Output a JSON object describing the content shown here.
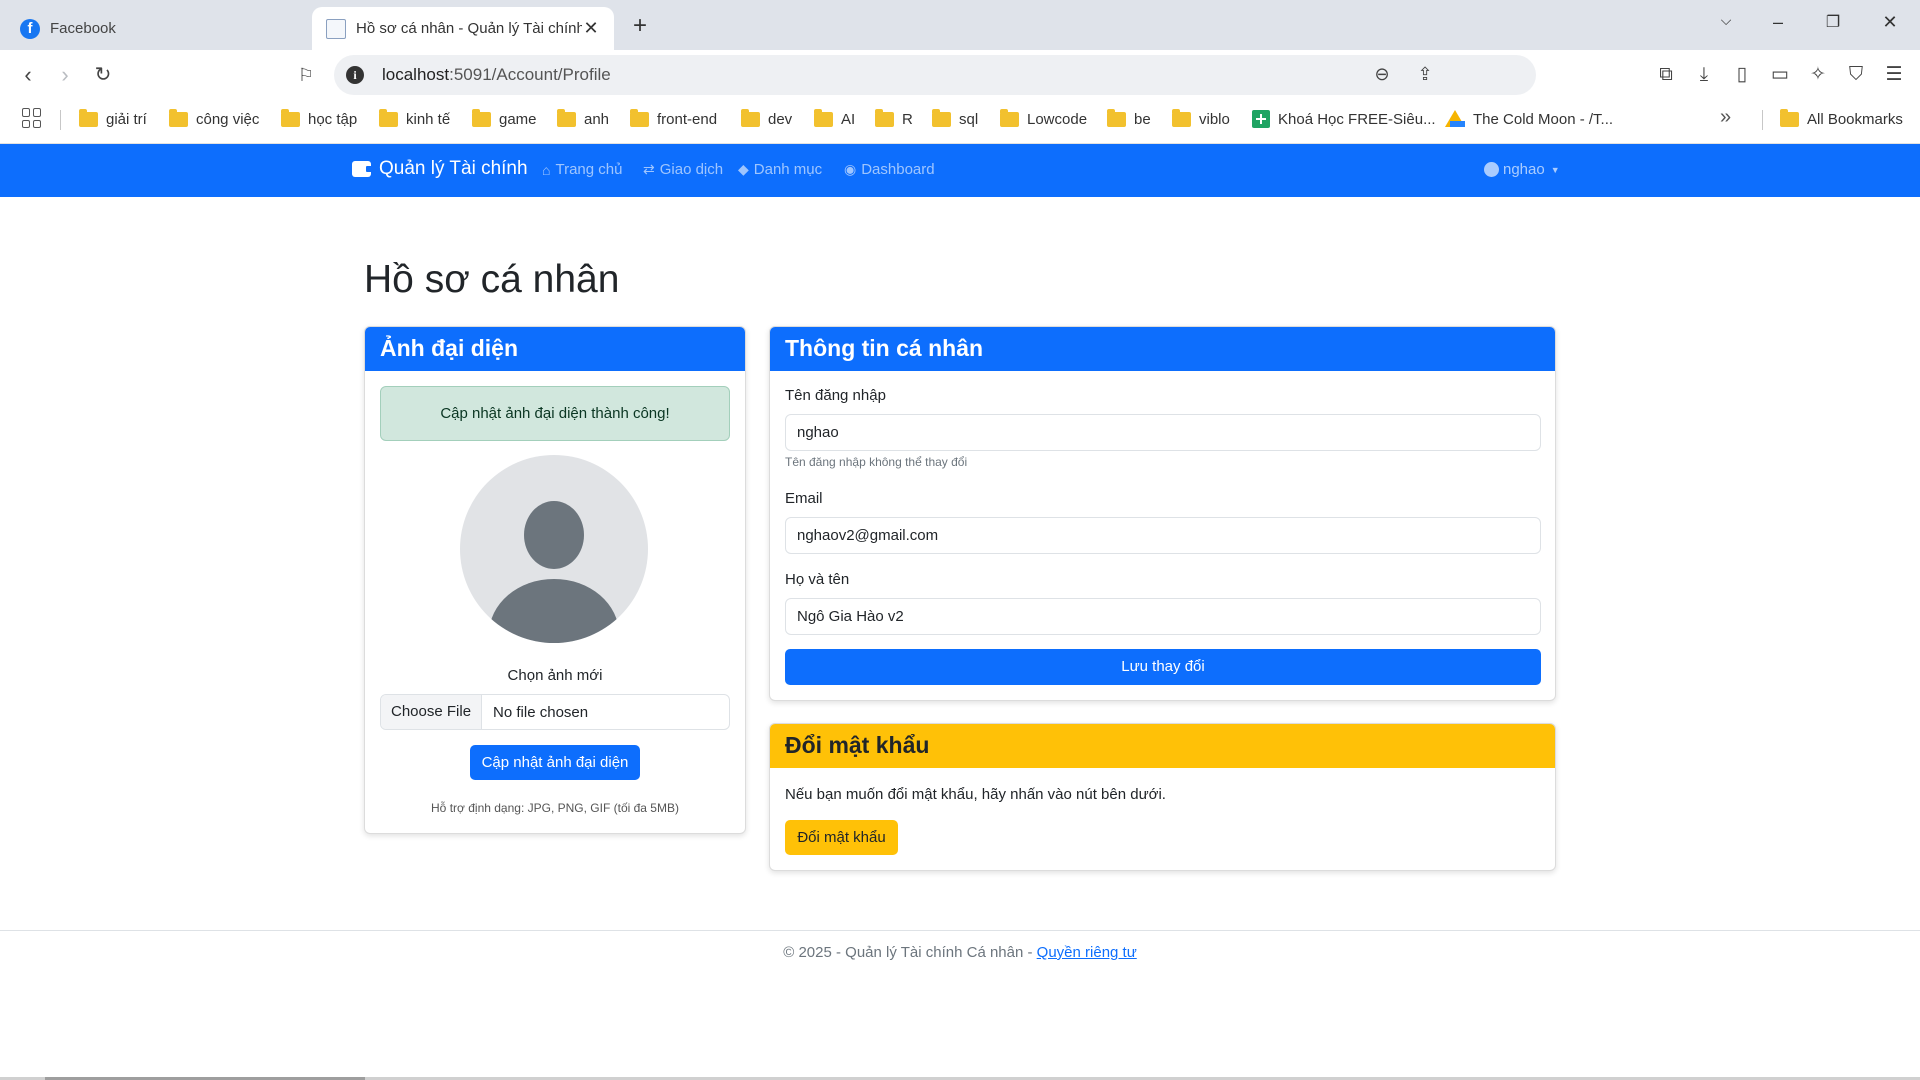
{
  "browser": {
    "tabs": [
      {
        "title": "Facebook",
        "icon": "facebook-icon",
        "active": false
      },
      {
        "title": "Hồ sơ cá nhân - Quản lý Tài chính",
        "icon": "document-icon",
        "active": true
      }
    ],
    "url_host": "localhost",
    "url_path": ":5091/Account/Profile",
    "bookmarks": [
      "giải trí",
      "công việc",
      "học tập",
      "kinh tế",
      "game",
      "anh",
      "front-end",
      "dev",
      "AI",
      "R",
      "sql",
      "Lowcode",
      "be",
      "viblo",
      "Khoá Học FREE-Siêu...",
      "The Cold Moon - /T...",
      "All Bookmarks"
    ]
  },
  "app": {
    "brand": "Quản lý Tài chính",
    "nav": [
      "Trang chủ",
      "Giao dịch",
      "Danh mục",
      "Dashboard"
    ],
    "user": "nghao",
    "accent_color": "#0d6efd",
    "warning_color": "#ffc107"
  },
  "page": {
    "title": "Hồ sơ cá nhân",
    "avatar_card": {
      "header": "Ảnh đại diện",
      "alert": "Cập nhật ảnh đại diện thành công!",
      "choose_label": "Chọn ảnh mới",
      "file_button": "Choose File",
      "file_status": "No file chosen",
      "submit": "Cập nhật ảnh đại diện",
      "hint": "Hỗ trợ định dạng: JPG, PNG, GIF (tối đa 5MB)"
    },
    "info_card": {
      "header": "Thông tin cá nhân",
      "username_label": "Tên đăng nhập",
      "username_value": "nghao",
      "username_help": "Tên đăng nhập không thể thay đổi",
      "email_label": "Email",
      "email_value": "nghaov2@gmail.com",
      "fullname_label": "Họ và tên",
      "fullname_value": "Ngô Gia Hào v2",
      "save": "Lưu thay đổi"
    },
    "password_card": {
      "header": "Đổi mật khẩu",
      "text": "Nếu bạn muốn đổi mật khẩu, hãy nhấn vào nút bên dưới.",
      "button": "Đổi mật khẩu"
    }
  },
  "footer": {
    "text": "© 2025 - Quản lý Tài chính Cá nhân - ",
    "privacy": "Quyền riêng tư"
  }
}
